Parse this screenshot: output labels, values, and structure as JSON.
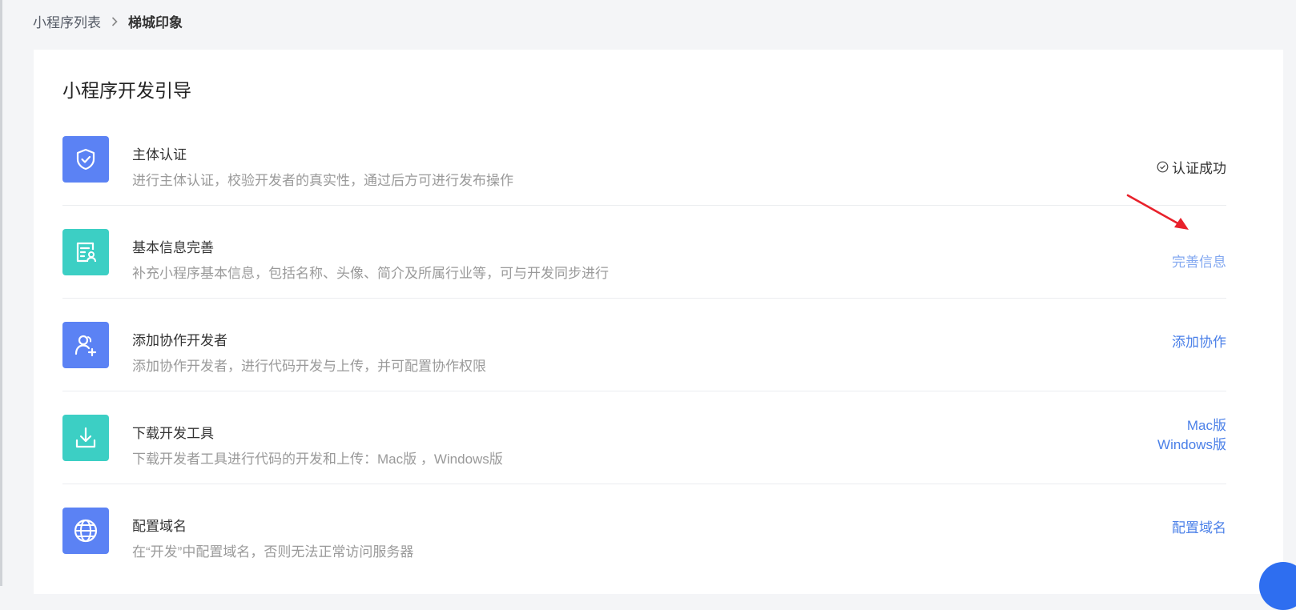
{
  "breadcrumb": {
    "parent": "小程序列表",
    "current": "梯城印象"
  },
  "panel": {
    "title": "小程序开发引导"
  },
  "steps": [
    {
      "title": "主体认证",
      "desc": "进行主体认证，校验开发者的真实性，通过后方可进行发布操作",
      "status": "认证成功",
      "icon": "shield-check-icon",
      "color": "#5b82f4"
    },
    {
      "title": "基本信息完善",
      "desc": "补充小程序基本信息，包括名称、头像、简介及所属行业等，可与开发同步进行",
      "action": "完善信息",
      "icon": "profile-card-icon",
      "color": "#3ccfc4"
    },
    {
      "title": "添加协作开发者",
      "desc": "添加协作开发者，进行代码开发与上传，并可配置协作权限",
      "action": "添加协作",
      "icon": "add-user-icon",
      "color": "#5b82f4"
    },
    {
      "title": "下载开发工具",
      "desc": "下载开发者工具进行代码的开发和上传：Mac版 ，Windows版",
      "actions": [
        "Mac版",
        "Windows版"
      ],
      "icon": "download-icon",
      "color": "#3ccfc4"
    },
    {
      "title": "配置域名",
      "desc": "在“开发”中配置域名，否则无法正常访问服务器",
      "action": "配置域名",
      "icon": "globe-icon",
      "color": "#5b82f4"
    }
  ],
  "colors": {
    "link": "#4b80e8",
    "annotation_arrow": "#e8212b"
  }
}
